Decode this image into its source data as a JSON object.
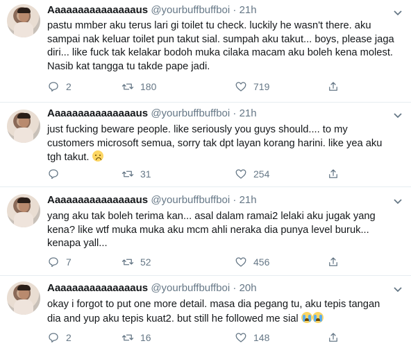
{
  "colors": {
    "text": "#14171a",
    "muted": "#657786",
    "divider": "#e6ecf0"
  },
  "icons": {
    "reply": "reply-icon",
    "retweet": "retweet-icon",
    "like": "heart-icon",
    "share": "share-icon",
    "more": "chevron-down-icon"
  },
  "tweets": [
    {
      "name": "Aaaaaaaaaaaaaaaus",
      "handle": "@yourbuffbuffboi",
      "sep": "·",
      "time": "21h",
      "lines": [
        "pastu mmber aku terus lari gi toilet tu check. luckily he wasn't there. aku",
        "sampai nak keluar toilet pun takut sial. sumpah aku takut... boys, please jaga",
        "diri... like fuck tak kelakar bodoh muka cilaka macam aku boleh kena molest.",
        "Nasib kat tangga tu takde pape jadi."
      ],
      "replies": "2",
      "retweets": "180",
      "likes": "719"
    },
    {
      "name": "Aaaaaaaaaaaaaaaus",
      "handle": "@yourbuffbuffboi",
      "sep": "·",
      "time": "21h",
      "lines": [
        "just fucking beware people. like seriously you guys should.... to my",
        "customers microsoft semua, sorry tak dpt layan korang harini. like yea aku",
        "tgh takut."
      ],
      "replies": "",
      "retweets": "31",
      "likes": "254"
    },
    {
      "name": "Aaaaaaaaaaaaaaaus",
      "handle": "@yourbuffbuffboi",
      "sep": "·",
      "time": "21h",
      "lines": [
        "yang aku tak boleh terima kan... asal dalam ramai2 lelaki aku jugak yang",
        "kena? like wtf muka muka aku mcm ahli neraka dia punya level buruk...",
        "kenapa yall..."
      ],
      "replies": "7",
      "retweets": "52",
      "likes": "456"
    },
    {
      "name": "Aaaaaaaaaaaaaaaus",
      "handle": "@yourbuffbuffboi",
      "sep": "·",
      "time": "20h",
      "lines": [
        "okay i forgot to put one more detail. masa dia pegang tu, aku tepis tangan",
        "dia and yup aku tepis kuat2. but still he followed me sial"
      ],
      "replies": "2",
      "retweets": "16",
      "likes": "148"
    }
  ]
}
